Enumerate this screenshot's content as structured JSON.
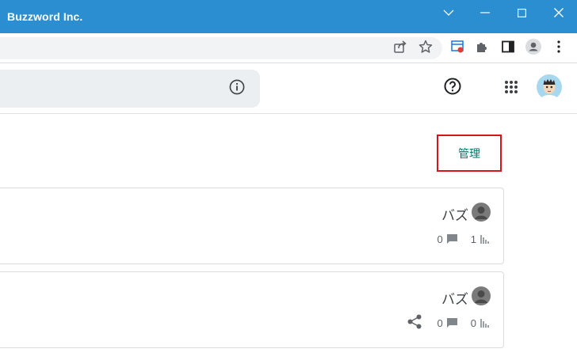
{
  "window": {
    "title": "Buzzword Inc.",
    "title_bar_color": "#2b8ed0"
  },
  "toolbar": {
    "icons": [
      "share-icon",
      "bookmark-star-icon",
      "extension-colored-icon",
      "puzzle-extensions-icon",
      "side-panel-icon",
      "profile-icon",
      "more-vert-icon"
    ]
  },
  "header": {
    "icons": [
      "info-icon",
      "help-icon",
      "apps-grid-icon",
      "user-avatar"
    ]
  },
  "manage": {
    "label": "管理",
    "text_color": "#00796b",
    "highlight_border_color": "#d9131a"
  },
  "posts": [
    {
      "author": "バズ",
      "comments": "0",
      "views": "1",
      "share_visible": false
    },
    {
      "author": "バズ",
      "comments": "0",
      "views": "0",
      "share_visible": true
    }
  ]
}
